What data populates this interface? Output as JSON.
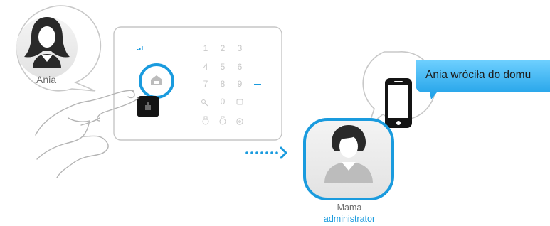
{
  "sender": {
    "name": "Ania",
    "icon": "woman-avatar-icon"
  },
  "panel": {
    "keys": [
      "1",
      "2",
      "3",
      "4",
      "5",
      "6",
      "7",
      "8",
      "9",
      "0"
    ],
    "icons": [
      "signal-icon",
      "keypad-key-icon",
      "tag-reader-icon",
      "arm-icon",
      "disarm-icon",
      "sos-icon",
      "home-icon"
    ]
  },
  "recipient": {
    "name": "Mama",
    "role": "administrator",
    "icon": "woman-avatar-icon"
  },
  "notification": {
    "text": "Ania wróciła do domu",
    "icon": "smartphone-icon"
  },
  "colors": {
    "accent": "#1a9bde",
    "sms_bubble": "#34b0f2",
    "outline": "#c8c8c8",
    "avatar": "#2a2a2a"
  }
}
